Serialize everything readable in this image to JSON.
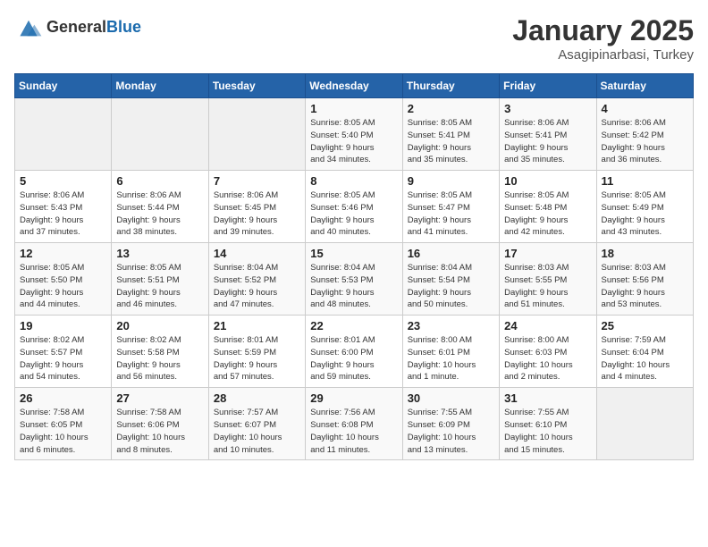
{
  "logo": {
    "general": "General",
    "blue": "Blue"
  },
  "title": "January 2025",
  "location": "Asagipinarbasi, Turkey",
  "weekdays": [
    "Sunday",
    "Monday",
    "Tuesday",
    "Wednesday",
    "Thursday",
    "Friday",
    "Saturday"
  ],
  "weeks": [
    [
      {
        "day": "",
        "info": ""
      },
      {
        "day": "",
        "info": ""
      },
      {
        "day": "",
        "info": ""
      },
      {
        "day": "1",
        "info": "Sunrise: 8:05 AM\nSunset: 5:40 PM\nDaylight: 9 hours\nand 34 minutes."
      },
      {
        "day": "2",
        "info": "Sunrise: 8:05 AM\nSunset: 5:41 PM\nDaylight: 9 hours\nand 35 minutes."
      },
      {
        "day": "3",
        "info": "Sunrise: 8:06 AM\nSunset: 5:41 PM\nDaylight: 9 hours\nand 35 minutes."
      },
      {
        "day": "4",
        "info": "Sunrise: 8:06 AM\nSunset: 5:42 PM\nDaylight: 9 hours\nand 36 minutes."
      }
    ],
    [
      {
        "day": "5",
        "info": "Sunrise: 8:06 AM\nSunset: 5:43 PM\nDaylight: 9 hours\nand 37 minutes."
      },
      {
        "day": "6",
        "info": "Sunrise: 8:06 AM\nSunset: 5:44 PM\nDaylight: 9 hours\nand 38 minutes."
      },
      {
        "day": "7",
        "info": "Sunrise: 8:06 AM\nSunset: 5:45 PM\nDaylight: 9 hours\nand 39 minutes."
      },
      {
        "day": "8",
        "info": "Sunrise: 8:05 AM\nSunset: 5:46 PM\nDaylight: 9 hours\nand 40 minutes."
      },
      {
        "day": "9",
        "info": "Sunrise: 8:05 AM\nSunset: 5:47 PM\nDaylight: 9 hours\nand 41 minutes."
      },
      {
        "day": "10",
        "info": "Sunrise: 8:05 AM\nSunset: 5:48 PM\nDaylight: 9 hours\nand 42 minutes."
      },
      {
        "day": "11",
        "info": "Sunrise: 8:05 AM\nSunset: 5:49 PM\nDaylight: 9 hours\nand 43 minutes."
      }
    ],
    [
      {
        "day": "12",
        "info": "Sunrise: 8:05 AM\nSunset: 5:50 PM\nDaylight: 9 hours\nand 44 minutes."
      },
      {
        "day": "13",
        "info": "Sunrise: 8:05 AM\nSunset: 5:51 PM\nDaylight: 9 hours\nand 46 minutes."
      },
      {
        "day": "14",
        "info": "Sunrise: 8:04 AM\nSunset: 5:52 PM\nDaylight: 9 hours\nand 47 minutes."
      },
      {
        "day": "15",
        "info": "Sunrise: 8:04 AM\nSunset: 5:53 PM\nDaylight: 9 hours\nand 48 minutes."
      },
      {
        "day": "16",
        "info": "Sunrise: 8:04 AM\nSunset: 5:54 PM\nDaylight: 9 hours\nand 50 minutes."
      },
      {
        "day": "17",
        "info": "Sunrise: 8:03 AM\nSunset: 5:55 PM\nDaylight: 9 hours\nand 51 minutes."
      },
      {
        "day": "18",
        "info": "Sunrise: 8:03 AM\nSunset: 5:56 PM\nDaylight: 9 hours\nand 53 minutes."
      }
    ],
    [
      {
        "day": "19",
        "info": "Sunrise: 8:02 AM\nSunset: 5:57 PM\nDaylight: 9 hours\nand 54 minutes."
      },
      {
        "day": "20",
        "info": "Sunrise: 8:02 AM\nSunset: 5:58 PM\nDaylight: 9 hours\nand 56 minutes."
      },
      {
        "day": "21",
        "info": "Sunrise: 8:01 AM\nSunset: 5:59 PM\nDaylight: 9 hours\nand 57 minutes."
      },
      {
        "day": "22",
        "info": "Sunrise: 8:01 AM\nSunset: 6:00 PM\nDaylight: 9 hours\nand 59 minutes."
      },
      {
        "day": "23",
        "info": "Sunrise: 8:00 AM\nSunset: 6:01 PM\nDaylight: 10 hours\nand 1 minute."
      },
      {
        "day": "24",
        "info": "Sunrise: 8:00 AM\nSunset: 6:03 PM\nDaylight: 10 hours\nand 2 minutes."
      },
      {
        "day": "25",
        "info": "Sunrise: 7:59 AM\nSunset: 6:04 PM\nDaylight: 10 hours\nand 4 minutes."
      }
    ],
    [
      {
        "day": "26",
        "info": "Sunrise: 7:58 AM\nSunset: 6:05 PM\nDaylight: 10 hours\nand 6 minutes."
      },
      {
        "day": "27",
        "info": "Sunrise: 7:58 AM\nSunset: 6:06 PM\nDaylight: 10 hours\nand 8 minutes."
      },
      {
        "day": "28",
        "info": "Sunrise: 7:57 AM\nSunset: 6:07 PM\nDaylight: 10 hours\nand 10 minutes."
      },
      {
        "day": "29",
        "info": "Sunrise: 7:56 AM\nSunset: 6:08 PM\nDaylight: 10 hours\nand 11 minutes."
      },
      {
        "day": "30",
        "info": "Sunrise: 7:55 AM\nSunset: 6:09 PM\nDaylight: 10 hours\nand 13 minutes."
      },
      {
        "day": "31",
        "info": "Sunrise: 7:55 AM\nSunset: 6:10 PM\nDaylight: 10 hours\nand 15 minutes."
      },
      {
        "day": "",
        "info": ""
      }
    ]
  ]
}
